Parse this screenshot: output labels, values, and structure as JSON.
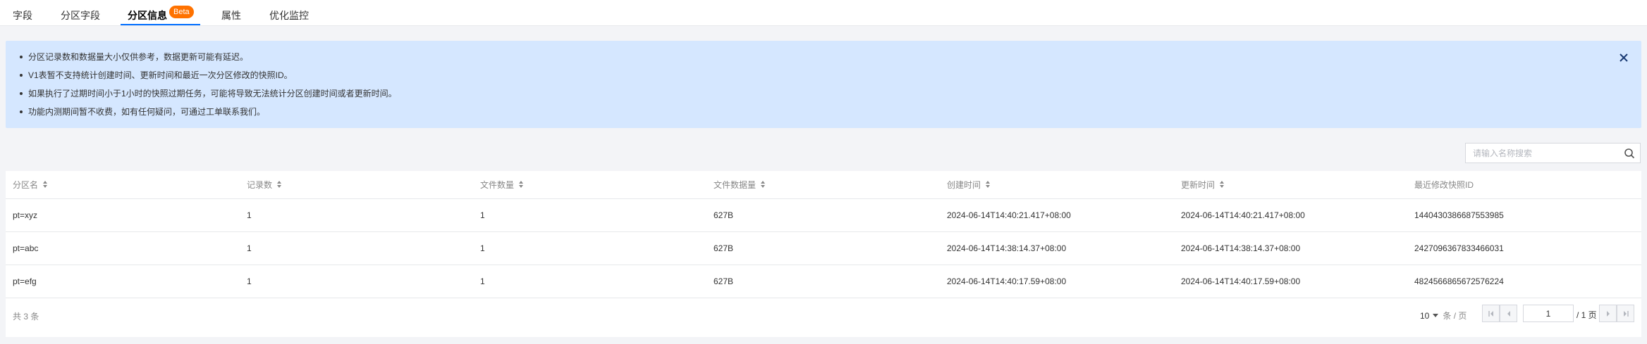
{
  "tabs": [
    {
      "label": "字段"
    },
    {
      "label": "分区字段"
    },
    {
      "label": "分区信息",
      "badge": "Beta"
    },
    {
      "label": "属性"
    },
    {
      "label": "优化监控"
    }
  ],
  "notice": {
    "items": [
      "分区记录数和数据量大小仅供参考，数据更新可能有延迟。",
      "V1表暂不支持统计创建时间、更新时间和最近一次分区修改的快照ID。",
      "如果执行了过期时间小于1小时的快照过期任务，可能将导致无法统计分区创建时间或者更新时间。",
      "功能内测期间暂不收费，如有任何疑问，可通过工单联系我们。"
    ],
    "close_icon": "close-icon"
  },
  "search": {
    "placeholder": "请输入名称搜索",
    "value": "",
    "icon": "search-icon"
  },
  "table": {
    "columns": [
      "分区名",
      "记录数",
      "文件数量",
      "文件数据量",
      "创建时间",
      "更新时间",
      "最近修改快照ID"
    ],
    "rows": [
      [
        "pt=xyz",
        "1",
        "1",
        "627B",
        "2024-06-14T14:40:21.417+08:00",
        "2024-06-14T14:40:21.417+08:00",
        "1440430386687553985"
      ],
      [
        "pt=abc",
        "1",
        "1",
        "627B",
        "2024-06-14T14:38:14.37+08:00",
        "2024-06-14T14:38:14.37+08:00",
        "2427096367833466031"
      ],
      [
        "pt=efg",
        "1",
        "1",
        "627B",
        "2024-06-14T14:40:17.59+08:00",
        "2024-06-14T14:40:17.59+08:00",
        "4824566865672576224"
      ]
    ]
  },
  "footer": {
    "total": "共 3 条",
    "page_size": "10",
    "page_size_unit": "条 / 页",
    "current_page": "1",
    "total_pages": "/ 1 页"
  },
  "colors": {
    "accent": "#006eff",
    "badge": "#ff7200",
    "notice_bg": "#d5e7ff"
  }
}
